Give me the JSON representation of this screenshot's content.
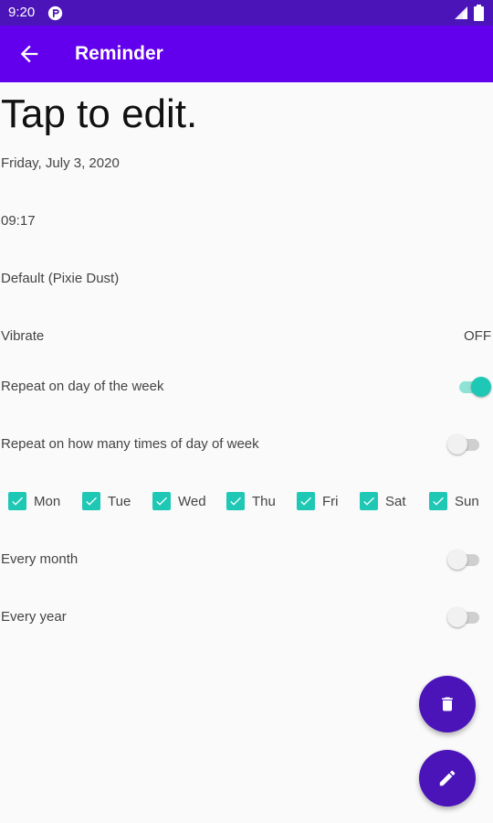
{
  "status_bar": {
    "time": "9:20"
  },
  "app_bar": {
    "title": "Reminder"
  },
  "content": {
    "title": "Tap to edit.",
    "date": "Friday, July 3, 2020",
    "time": "09:17",
    "ringtone": "Default (Pixie Dust)",
    "vibrate": {
      "label": "Vibrate",
      "value": "OFF"
    },
    "repeat_day_of_week": {
      "label": "Repeat on day of the week",
      "on": true
    },
    "repeat_times_day_of_week": {
      "label": "Repeat on how many times of day of week",
      "on": false
    },
    "days": [
      {
        "label": "Mon",
        "checked": true
      },
      {
        "label": "Tue",
        "checked": true
      },
      {
        "label": "Wed",
        "checked": true
      },
      {
        "label": "Thu",
        "checked": true
      },
      {
        "label": "Fri",
        "checked": true
      },
      {
        "label": "Sat",
        "checked": true
      },
      {
        "label": "Sun",
        "checked": true
      }
    ],
    "every_month": {
      "label": "Every month",
      "on": false
    },
    "every_year": {
      "label": "Every year",
      "on": false
    }
  },
  "fabs": {
    "delete_icon": "trash-icon",
    "edit_icon": "pencil-icon"
  },
  "colors": {
    "status_bar": "#4a14b8",
    "app_bar": "#6200ee",
    "accent": "#1ec8b5",
    "fab": "#4a14b8"
  }
}
